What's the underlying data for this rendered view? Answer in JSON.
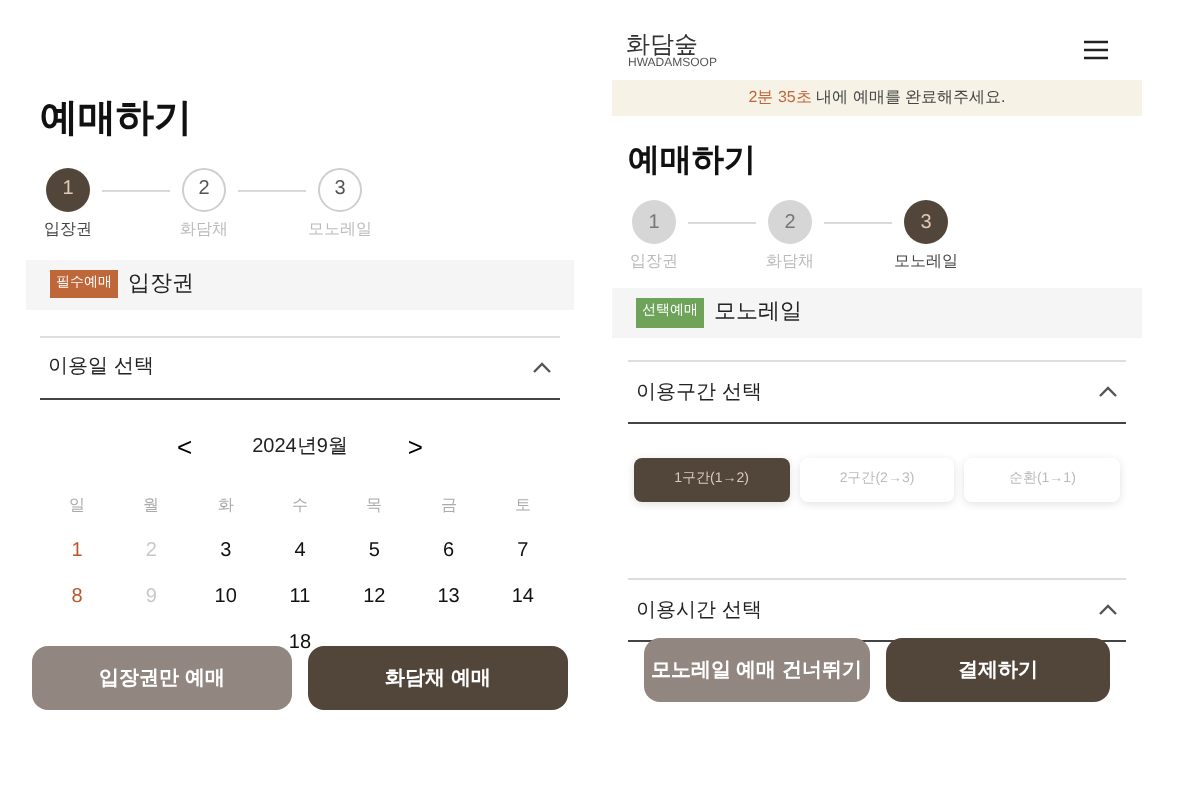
{
  "left": {
    "title": "예매하기",
    "steps": [
      {
        "number": "1",
        "label": "입장권",
        "current": true,
        "done": false
      },
      {
        "number": "2",
        "label": "화담채",
        "current": false,
        "done": false
      },
      {
        "number": "3",
        "label": "모노레일",
        "current": false,
        "done": false
      }
    ],
    "ticket": {
      "badge": "필수예매",
      "color": "#c0673a",
      "name": "입장권"
    },
    "accordion": {
      "title": "이용일 선택",
      "expanded": true
    },
    "calendar": {
      "prev": "<",
      "month": "2024년9월",
      "next": ">",
      "weekdays": [
        "일",
        "월",
        "화",
        "수",
        "목",
        "금",
        "토"
      ],
      "weeks": [
        [
          {
            "day": "1",
            "kind": "sunday"
          },
          {
            "day": "2",
            "kind": "disabled"
          },
          {
            "day": "3",
            "kind": "normal"
          },
          {
            "day": "4",
            "kind": "normal"
          },
          {
            "day": "5",
            "kind": "normal"
          },
          {
            "day": "6",
            "kind": "normal"
          },
          {
            "day": "7",
            "kind": "normal"
          }
        ],
        [
          {
            "day": "8",
            "kind": "sunday"
          },
          {
            "day": "9",
            "kind": "disabled"
          },
          {
            "day": "10",
            "kind": "normal"
          },
          {
            "day": "11",
            "kind": "normal"
          },
          {
            "day": "12",
            "kind": "normal"
          },
          {
            "day": "13",
            "kind": "normal"
          },
          {
            "day": "14",
            "kind": "normal"
          }
        ],
        [
          {
            "day": "18",
            "kind": "normal"
          }
        ]
      ]
    },
    "buttons": [
      {
        "label": "입장권만 예매",
        "kind": "secondary"
      },
      {
        "label": "화담채 예매",
        "kind": "primary"
      }
    ]
  },
  "right": {
    "logo": "화담숲",
    "logo_sub": "HWADAMSOOP",
    "notice": {
      "time": "2분 35초",
      "text": " 내에 예매를 완료해주세요."
    },
    "title": "예매하기",
    "steps": [
      {
        "number": "1",
        "label": "입장권",
        "current": false,
        "done": true
      },
      {
        "number": "2",
        "label": "화담채",
        "current": false,
        "done": true
      },
      {
        "number": "3",
        "label": "모노레일",
        "current": true,
        "done": false
      }
    ],
    "ticket": {
      "badge": "선택예매",
      "color": "#6fa35a",
      "name": "모노레일"
    },
    "section_accordion": {
      "title": "이용구간 선택",
      "expanded": true
    },
    "sections": [
      {
        "label": "1구간(1→2)",
        "selected": true
      },
      {
        "label": "2구간(2→3)",
        "selected": false
      },
      {
        "label": "순환(1→1)",
        "selected": false
      }
    ],
    "time_accordion": {
      "title": "이용시간 선택",
      "expanded": true
    },
    "buttons": [
      {
        "label": "모노레일 예매 건너뛰기",
        "kind": "secondary"
      },
      {
        "label": "결제하기",
        "kind": "primary"
      }
    ]
  }
}
